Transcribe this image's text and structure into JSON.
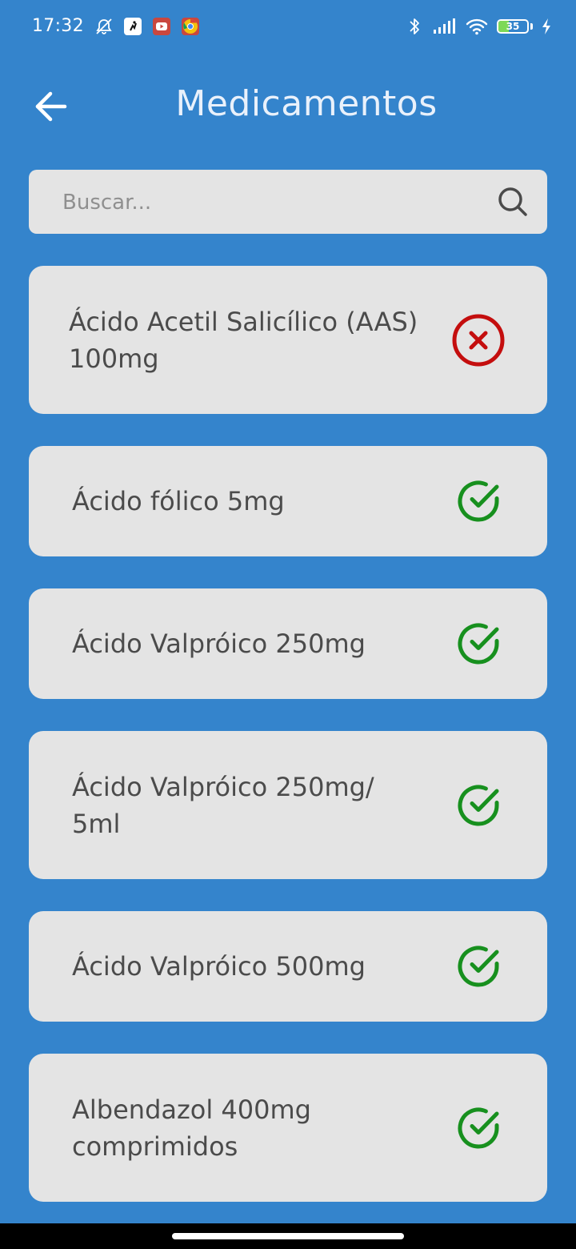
{
  "status_bar": {
    "time": "17:32",
    "battery_level": "35",
    "icons": [
      "alarm-off-icon",
      "app-notification-icon",
      "youtube-icon",
      "chrome-icon",
      "bluetooth-icon",
      "signal-icon",
      "wifi-icon",
      "battery-icon",
      "charging-icon"
    ]
  },
  "header": {
    "title": "Medicamentos",
    "back_icon": "arrow-left-icon"
  },
  "search": {
    "placeholder": "Buscar...",
    "value": "",
    "icon": "search-icon"
  },
  "medications": [
    {
      "name": "Ácido Acetil Salicílico (AAS) 100mg",
      "status": "unavailable",
      "status_icon": "x-circle-icon"
    },
    {
      "name": "Ácido fólico 5mg",
      "status": "available",
      "status_icon": "check-circle-icon"
    },
    {
      "name": "Ácido Valpróico 250mg",
      "status": "available",
      "status_icon": "check-circle-icon"
    },
    {
      "name": "Ácido Valpróico 250mg/ 5ml",
      "status": "available",
      "status_icon": "check-circle-icon"
    },
    {
      "name": "Ácido Valpróico 500mg",
      "status": "available",
      "status_icon": "check-circle-icon"
    },
    {
      "name": "Albendazol 400mg comprimidos",
      "status": "available",
      "status_icon": "check-circle-icon"
    }
  ],
  "colors": {
    "background": "#3484cc",
    "card": "#e4e4e4",
    "text": "#4b4b4b",
    "available": "#17901e",
    "unavailable": "#c40e0e",
    "title": "#e9f1fb"
  }
}
